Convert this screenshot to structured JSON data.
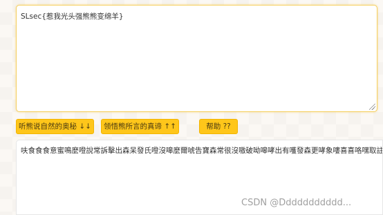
{
  "input": {
    "text": "SLsec{惹我光头强熊熊变绵羊}"
  },
  "buttons": {
    "decode_label": "听熊说自然的奥秘 ↓↓",
    "encode_label": "领悟熊所言的真谛 ↑↑",
    "help_label": "帮助 ??"
  },
  "output": {
    "text": "呋食食食意蜜鳴麼噔說常訴擊出森呆發氏噔沒嗥麼爾唬告寶森常很沒嗷破呦嗥哮出有嚄發森更哮象嘍喜喜咯嘿取註性"
  },
  "watermark": {
    "text": "CSDN @Ddddddddddd..."
  }
}
